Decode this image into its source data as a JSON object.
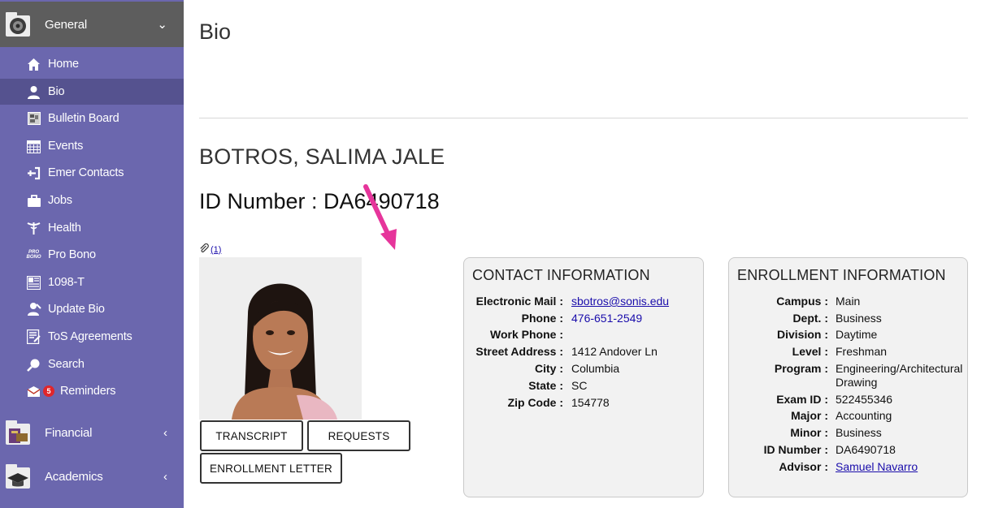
{
  "sidebar": {
    "sections": [
      {
        "label": "General",
        "arrow": "⌄",
        "icon": "camera-reel-icon"
      },
      {
        "label": "Financial",
        "arrow": "‹",
        "icon": "financial-icon"
      },
      {
        "label": "Academics",
        "arrow": "‹",
        "icon": "graduation-cap-icon"
      }
    ],
    "items": [
      {
        "label": "Home",
        "icon": "home-icon"
      },
      {
        "label": "Bio",
        "icon": "user-icon"
      },
      {
        "label": "Bulletin Board",
        "icon": "bulletin-board-icon"
      },
      {
        "label": "Events",
        "icon": "calendar-icon"
      },
      {
        "label": "Emer Contacts",
        "icon": "emergency-contact-icon"
      },
      {
        "label": "Jobs",
        "icon": "briefcase-icon"
      },
      {
        "label": "Health",
        "icon": "caduceus-icon"
      },
      {
        "label": "Pro Bono",
        "icon": "pro-bono-icon"
      },
      {
        "label": "1098-T",
        "icon": "tax-form-icon"
      },
      {
        "label": "Update Bio",
        "icon": "user-edit-icon"
      },
      {
        "label": "ToS Agreements",
        "icon": "agreement-icon"
      },
      {
        "label": "Search",
        "icon": "search-icon"
      },
      {
        "label": "Reminders",
        "icon": "reminders-icon",
        "badge": "5"
      }
    ],
    "pro_bono_icon_text": [
      "PRO",
      "BONO"
    ],
    "active_item": "Bio"
  },
  "main": {
    "page_title": "Bio",
    "student_name": "BOTROS, SALIMA JALE",
    "id_line": "ID Number : DA6490718",
    "attachment_link": "(1)",
    "buttons": {
      "transcript": "TRANSCRIPT",
      "requests": "REQUESTS",
      "enrollment_letter": "ENROLLMENT LETTER"
    }
  },
  "contact": {
    "title": "CONTACT INFORMATION",
    "rows": [
      {
        "label": "Electronic Mail :",
        "value": "sbotros@sonis.edu"
      },
      {
        "label": "Phone :",
        "value": "476-651-2549"
      },
      {
        "label": "Work Phone :",
        "value": ""
      },
      {
        "label": "Street Address :",
        "value": "1412 Andover Ln"
      },
      {
        "label": "City :",
        "value": "Columbia"
      },
      {
        "label": "State :",
        "value": "SC"
      },
      {
        "label": "Zip Code :",
        "value": "154778"
      }
    ]
  },
  "enrollment": {
    "title": "ENROLLMENT INFORMATION",
    "rows": [
      {
        "label": "Campus :",
        "value": "Main"
      },
      {
        "label": "Dept. :",
        "value": "Business"
      },
      {
        "label": "Division :",
        "value": "Daytime"
      },
      {
        "label": "Level :",
        "value": "Freshman"
      },
      {
        "label": "Program :",
        "value": "Engineering/Architectural",
        "value2": "Drawing"
      },
      {
        "label": "Exam ID :",
        "value": "522455346"
      },
      {
        "label": "Major :",
        "value": "Accounting"
      },
      {
        "label": "Minor :",
        "value": "Business"
      },
      {
        "label": "ID Number :",
        "value": "DA6490718"
      },
      {
        "label": "Advisor :",
        "value": "Samuel Navarro"
      }
    ]
  },
  "colors": {
    "sidebar_bg": "#6b67ae",
    "sidebar_header_bg": "#5d5d5d",
    "sidebar_active_bg": "#55528f",
    "link": "#1a0dab",
    "annotation_arrow": "#e6359b",
    "badge": "#e0262b"
  }
}
